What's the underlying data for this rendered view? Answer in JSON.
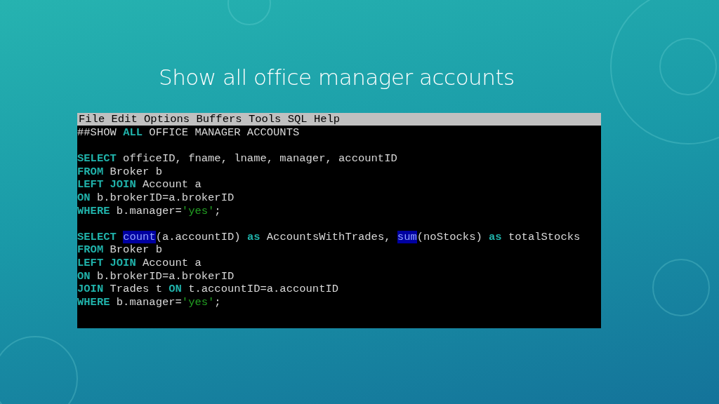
{
  "slide": {
    "title": "Show all office manager accounts"
  },
  "editor": {
    "menu": [
      "File",
      "Edit",
      "Options",
      "Buffers",
      "Tools",
      "SQL",
      "Help"
    ],
    "lines": [
      {
        "kind": "code",
        "tokens": [
          {
            "text": "##SHOW ",
            "kind": "plain"
          },
          {
            "text": "ALL",
            "kind": "keyword"
          },
          {
            "text": " OFFICE MANAGER ACCOUNTS",
            "kind": "plain"
          }
        ]
      },
      {
        "kind": "blank"
      },
      {
        "kind": "code",
        "tokens": [
          {
            "text": "SELECT",
            "kind": "keyword"
          },
          {
            "text": " officeID, fname, lname, manager, accountID",
            "kind": "plain"
          }
        ]
      },
      {
        "kind": "code",
        "tokens": [
          {
            "text": "FROM",
            "kind": "keyword"
          },
          {
            "text": " Broker b",
            "kind": "plain"
          }
        ]
      },
      {
        "kind": "code",
        "tokens": [
          {
            "text": "LEFT JOIN",
            "kind": "keyword"
          },
          {
            "text": " Account a",
            "kind": "plain"
          }
        ]
      },
      {
        "kind": "code",
        "tokens": [
          {
            "text": "ON",
            "kind": "keyword"
          },
          {
            "text": " b.brokerID=a.brokerID",
            "kind": "plain"
          }
        ]
      },
      {
        "kind": "code",
        "tokens": [
          {
            "text": "WHERE",
            "kind": "keyword"
          },
          {
            "text": " b.manager=",
            "kind": "plain"
          },
          {
            "text": "'yes'",
            "kind": "string"
          },
          {
            "text": ";",
            "kind": "plain"
          }
        ]
      },
      {
        "kind": "blank"
      },
      {
        "kind": "code",
        "tokens": [
          {
            "text": "SELECT ",
            "kind": "keyword"
          },
          {
            "text": "count",
            "kind": "builtin"
          },
          {
            "text": "(a.accountID) ",
            "kind": "plain"
          },
          {
            "text": "as",
            "kind": "keyword"
          },
          {
            "text": " AccountsWithTrades, ",
            "kind": "plain"
          },
          {
            "text": "sum",
            "kind": "builtin"
          },
          {
            "text": "(noStocks) ",
            "kind": "plain"
          },
          {
            "text": "as",
            "kind": "keyword"
          },
          {
            "text": " totalStocks",
            "kind": "plain"
          }
        ]
      },
      {
        "kind": "code",
        "tokens": [
          {
            "text": "FROM",
            "kind": "keyword"
          },
          {
            "text": " Broker b",
            "kind": "plain"
          }
        ]
      },
      {
        "kind": "code",
        "tokens": [
          {
            "text": "LEFT JOIN",
            "kind": "keyword"
          },
          {
            "text": " Account a",
            "kind": "plain"
          }
        ]
      },
      {
        "kind": "code",
        "tokens": [
          {
            "text": "ON",
            "kind": "keyword"
          },
          {
            "text": " b.brokerID=a.brokerID",
            "kind": "plain"
          }
        ]
      },
      {
        "kind": "code",
        "tokens": [
          {
            "text": "JOIN",
            "kind": "keyword"
          },
          {
            "text": " Trades t ",
            "kind": "plain"
          },
          {
            "text": "ON",
            "kind": "keyword"
          },
          {
            "text": " t.accountID=a.accountID",
            "kind": "plain"
          }
        ]
      },
      {
        "kind": "code",
        "tokens": [
          {
            "text": "WHERE",
            "kind": "keyword"
          },
          {
            "text": " b.manager=",
            "kind": "plain"
          },
          {
            "text": "'yes'",
            "kind": "string"
          },
          {
            "text": ";",
            "kind": "plain"
          }
        ]
      }
    ]
  }
}
